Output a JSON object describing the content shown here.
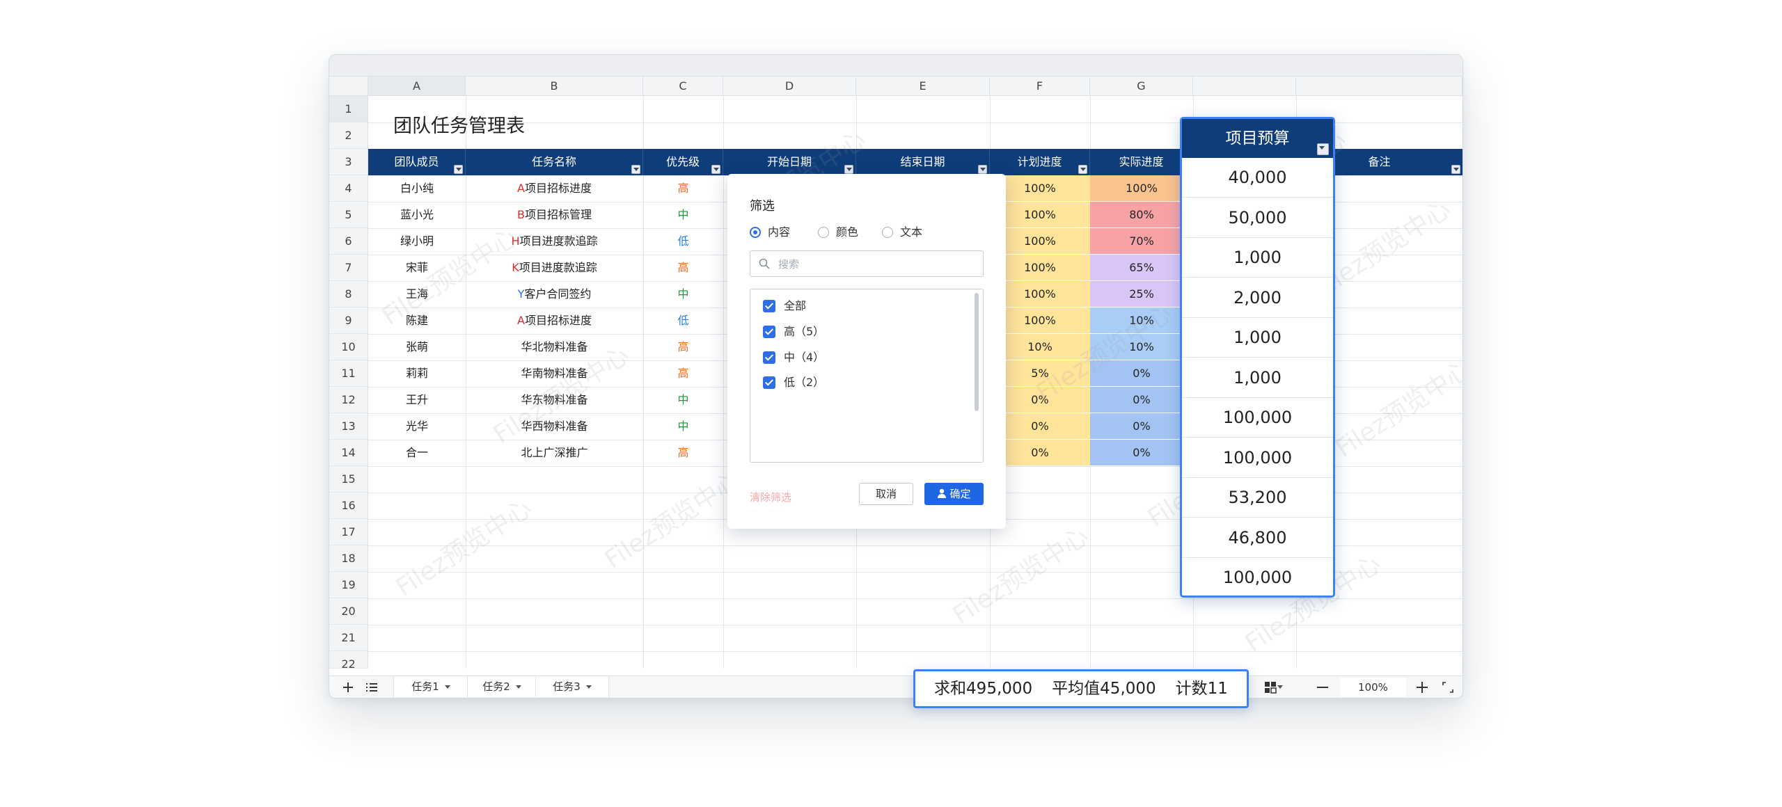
{
  "sheet_title": "团队任务管理表",
  "column_letters": [
    "A",
    "B",
    "C",
    "D",
    "E",
    "F",
    "G",
    "",
    ""
  ],
  "row_numbers": [
    "1",
    "2",
    "3",
    "4",
    "5",
    "6",
    "7",
    "8",
    "9",
    "10",
    "11",
    "12",
    "13",
    "14",
    "15",
    "16",
    "17",
    "18",
    "19",
    "20",
    "21",
    "22"
  ],
  "headers": [
    "团队成员",
    "任务名称",
    "优先级",
    "开始日期",
    "结束日期",
    "计划进度",
    "实际进度",
    "",
    "备注"
  ],
  "rows": [
    {
      "member": "白小纯",
      "task_prefix": "A",
      "task": "项目招标进度",
      "priority": "高",
      "plan": "100%",
      "actual": "100%"
    },
    {
      "member": "蓝小光",
      "task_prefix": "B",
      "task": "项目招标管理",
      "priority": "中",
      "plan": "100%",
      "actual": "80%"
    },
    {
      "member": "绿小明",
      "task_prefix": "H",
      "task": "项目进度款追踪",
      "priority": "低",
      "plan": "100%",
      "actual": "70%"
    },
    {
      "member": "宋菲",
      "task_prefix": "K",
      "task": "项目进度款追踪",
      "priority": "高",
      "plan": "100%",
      "actual": "65%"
    },
    {
      "member": "王海",
      "task_prefix": "Y",
      "task": "客户合同签约",
      "priority": "中",
      "plan": "100%",
      "actual": "25%"
    },
    {
      "member": "陈建",
      "task_prefix": "A",
      "task": "项目招标进度",
      "priority": "低",
      "plan": "100%",
      "actual": "10%"
    },
    {
      "member": "张萌",
      "task_prefix": "",
      "task": "华北物料准备",
      "priority": "高",
      "plan": "10%",
      "actual": "10%"
    },
    {
      "member": "莉莉",
      "task_prefix": "",
      "task": "华南物料准备",
      "priority": "高",
      "plan": "5%",
      "actual": "0%"
    },
    {
      "member": "王升",
      "task_prefix": "",
      "task": "华东物料准备",
      "priority": "中",
      "plan": "0%",
      "actual": "0%"
    },
    {
      "member": "光华",
      "task_prefix": "",
      "task": "华西物料准备",
      "priority": "中",
      "plan": "0%",
      "actual": "0%"
    },
    {
      "member": "合一",
      "task_prefix": "",
      "task": "北上广深推广",
      "priority": "高",
      "plan": "0%",
      "actual": "0%"
    }
  ],
  "colors": {
    "header_bg": "#0f3d7a",
    "priority_high": "#f06a22",
    "priority_mid": "#179c3b",
    "priority_low": "#2980e0",
    "plan_fill": "#ffe49a",
    "actual_100": "#f9c38e",
    "actual_80": "#f7a3a6",
    "actual_65": "#d9c6f7",
    "actual_10": "#a9cdf5",
    "actual_0": "#a3c4f3",
    "accent": "#3b82f6"
  },
  "budget": {
    "header": "项目预算",
    "values": [
      "40,000",
      "50,000",
      "1,000",
      "2,000",
      "1,000",
      "1,000",
      "100,000",
      "100,000",
      "53,200",
      "46,800",
      "100,000"
    ]
  },
  "filter_dialog": {
    "title": "筛选",
    "modes": [
      "内容",
      "颜色",
      "文本"
    ],
    "selected_mode": "内容",
    "search_placeholder": "搜索",
    "options": [
      "全部",
      "高（5）",
      "中（4）",
      "低（2）"
    ],
    "clear_label": "清除筛选",
    "cancel_label": "取消",
    "ok_label": "确定"
  },
  "sheet_tabs": [
    "任务1",
    "任务2",
    "任务3"
  ],
  "status": {
    "sum": "求和495,000",
    "avg": "平均值45,000",
    "count": "计数11"
  },
  "zoom": "100%",
  "watermark_text": "Filez预览中心",
  "icons": [
    "add-sheet-icon",
    "sheet-list-icon",
    "filter-icon",
    "search-icon",
    "user-icon",
    "view-mode-icon",
    "zoom-out-icon",
    "zoom-in-icon",
    "fullscreen-icon"
  ]
}
